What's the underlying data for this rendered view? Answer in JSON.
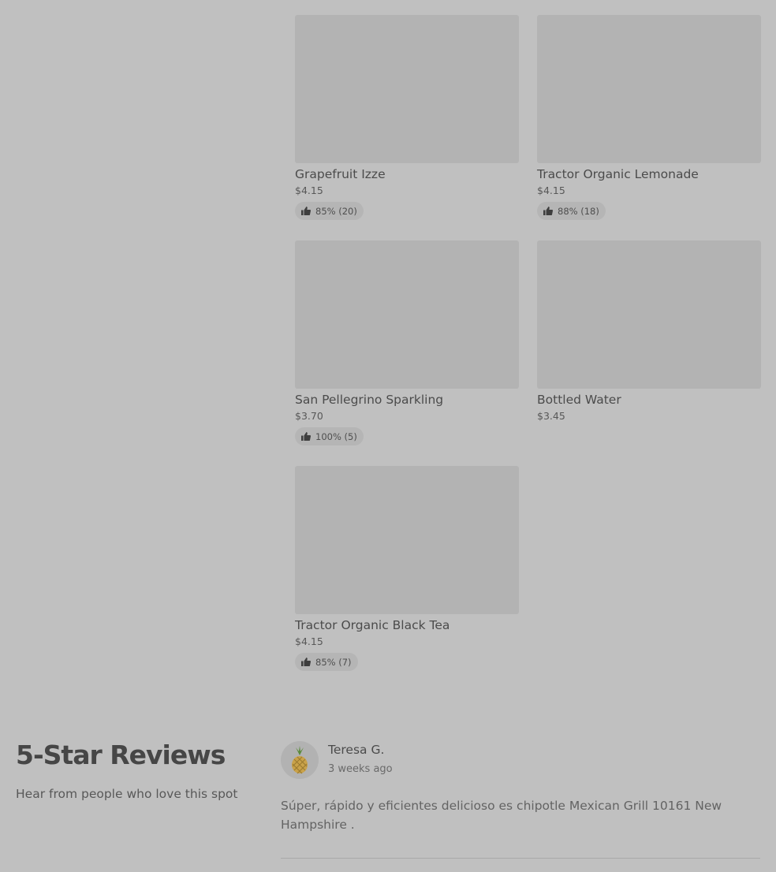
{
  "items": [
    {
      "name": "Grapefruit Izze",
      "price": "$4.15",
      "rating": "85% (20)"
    },
    {
      "name": "Tractor Organic Lemonade",
      "price": "$4.15",
      "rating": "88% (18)"
    },
    {
      "name": "San Pellegrino Sparkling",
      "price": "$3.70",
      "rating": "100% (5)"
    },
    {
      "name": "Bottled Water",
      "price": "$3.45"
    },
    {
      "name": "Tractor Organic Black Tea",
      "price": "$4.15",
      "rating": "85% (7)"
    }
  ],
  "reviews_section": {
    "title": "5-Star Reviews",
    "subtitle": "Hear from people who love this spot",
    "review": {
      "reviewer": "Teresa G.",
      "date": "3 weeks ago",
      "text": "Súper, rápido y eficientes delicioso es chipotle Mexican Grill 10161 New Hampshire .",
      "avatar_icon": "pineapple-icon"
    }
  },
  "colors": {
    "background": "#c0c0c0",
    "thumbnail": "#b3b3b3",
    "rating_pill": "#b5b5b5"
  },
  "icons": {
    "rating": "thumbs-up-icon"
  }
}
